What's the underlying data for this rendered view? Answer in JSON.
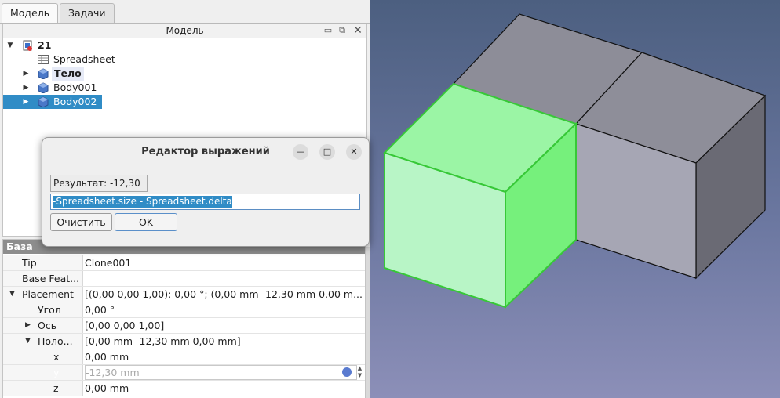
{
  "tabs": [
    "Модель",
    "Задачи"
  ],
  "tree": {
    "header": "Модель",
    "root": "21",
    "items": [
      "Spreadsheet",
      "Тело",
      "Body001",
      "Body002"
    ]
  },
  "dialog": {
    "title": "Редактор выражений",
    "result": "Результат: -12,30",
    "expression": "-Spreadsheet.size - Spreadsheet.delta",
    "clear": "Очистить",
    "ok": "OK"
  },
  "props": {
    "group": "База",
    "rows": [
      {
        "name": "Tip",
        "value": "Clone001"
      },
      {
        "name": "Base Feat...",
        "value": ""
      },
      {
        "name": "Placement",
        "value": "[(0,00 0,00 1,00); 0,00 °; (0,00 mm  -12,30 mm  0,00 m..."
      },
      {
        "name": "Угол",
        "value": "0,00 °"
      },
      {
        "name": "Ось",
        "value": "[0,00 0,00 1,00]"
      },
      {
        "name": "Поло...",
        "value": "[0,00 mm  -12,30 mm  0,00 mm]"
      },
      {
        "name": "x",
        "value": "0,00 mm"
      },
      {
        "name": "y",
        "value": "-12,30 mm"
      },
      {
        "name": "z",
        "value": "0,00 mm"
      }
    ]
  },
  "colors": {
    "selection": "#308cc6",
    "green_face": "#b8f5c6",
    "gray_face": "#8a8a99"
  }
}
